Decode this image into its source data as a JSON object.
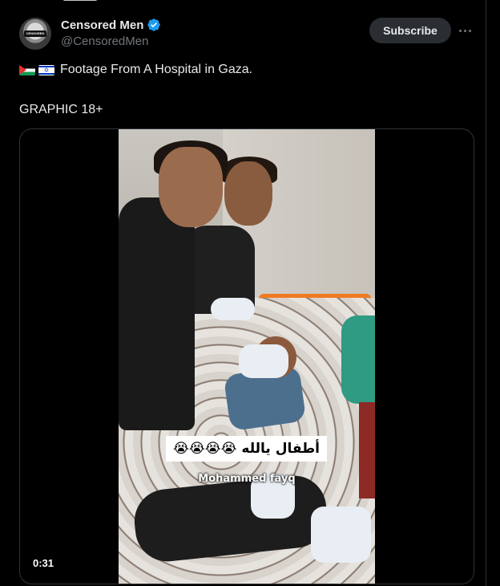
{
  "author": {
    "display_name": "Censored Men",
    "handle": "@CensoredMen",
    "avatar_text": "CENSORED"
  },
  "header": {
    "subscribe_label": "Subscribe"
  },
  "tweet": {
    "flags": [
      "palestine-flag",
      "israel-flag"
    ],
    "line1": "Footage From A Hospital in Gaza.",
    "line2": "GRAPHIC 18+"
  },
  "video": {
    "caption_arabic": "أطفال يالله 😭😭😭😭",
    "caption_name": "Mohammed fayq",
    "duration": "0:31"
  },
  "colors": {
    "background": "#000000",
    "text": "#e7e9ea",
    "secondary": "#71767b",
    "verified": "#1d9bf0",
    "subscribe_bg": "#2a2e32"
  }
}
